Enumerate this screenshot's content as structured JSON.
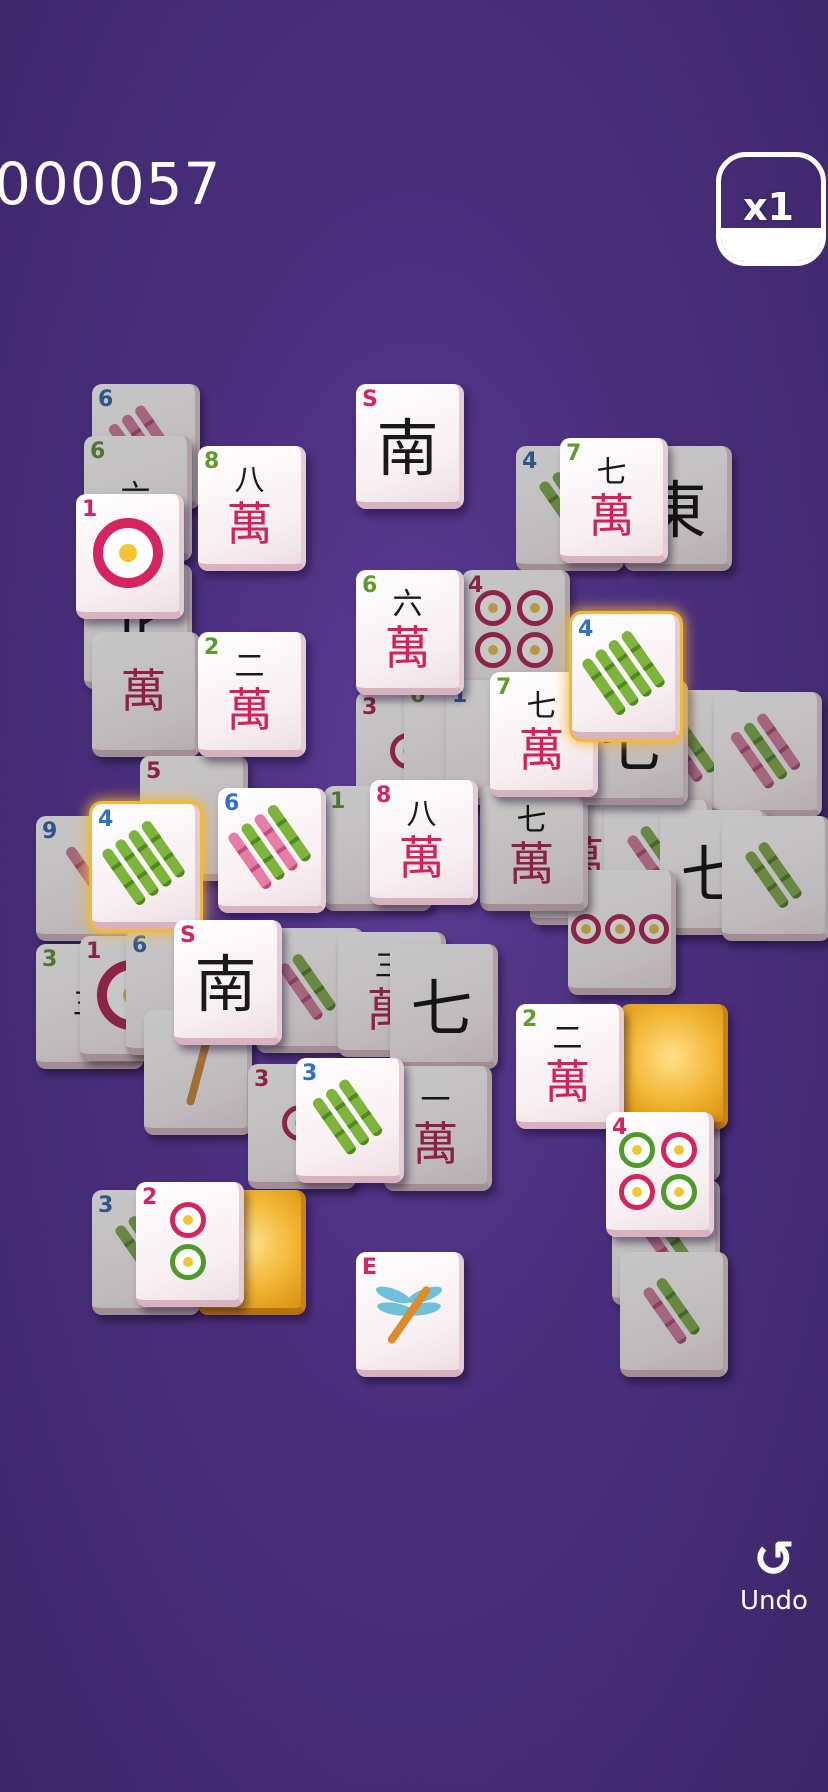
{
  "header": {
    "score": "000057",
    "multiplier": "x1"
  },
  "footer": {
    "undo_label": "Undo"
  },
  "icons": {
    "undo": "undo-arrow-icon",
    "multiplier": "multiplier-badge-icon"
  },
  "colors": {
    "background": "#4a2f7d",
    "character_red": "#d4215a",
    "bamboo_green": "#5e9b2c",
    "highlight_gold": "#f5b530"
  },
  "tiles": {
    "t1": {
      "num": "6"
    },
    "t2": {
      "num": "6",
      "top": "六"
    },
    "t3": {
      "num": "1"
    },
    "t4": {
      "num": "8",
      "top": "八",
      "wan": "萬"
    },
    "t5": {
      "num": "S",
      "big": "南"
    },
    "t6": {
      "num": "4"
    },
    "t7": {
      "num": "7",
      "top": "七",
      "wan": "萬"
    },
    "t8": {
      "big": "北"
    },
    "t9": {
      "num": "2",
      "top": "二",
      "wan": "萬"
    },
    "t10": {
      "wan": "萬"
    },
    "t11": {
      "num": "6",
      "top": "六",
      "wan": "萬"
    },
    "t12": {
      "num": "4"
    },
    "t13": {
      "num": "4"
    },
    "t14": {
      "num": "7",
      "top": "七",
      "wan": "萬"
    },
    "t15": {
      "num": "3"
    },
    "t16": {
      "num": "6"
    },
    "t17": {
      "num": "1"
    },
    "t18": {
      "num": "5"
    },
    "t19": {
      "num": "9"
    },
    "t20": {
      "num": "4"
    },
    "t21": {
      "num": "6"
    },
    "t22": {
      "num": "1"
    },
    "t23": {
      "num": "8",
      "top": "八",
      "wan": "萬"
    },
    "t24": {
      "num": "3"
    },
    "t25": {
      "num": "1"
    },
    "t26": {
      "num": "6"
    },
    "t27": {
      "num": "S",
      "big": "南"
    },
    "t28": {
      "num": "2",
      "top": "二",
      "wan": "萬"
    },
    "t29": {
      "num": "8"
    },
    "t30": {
      "num": "4"
    },
    "t31": {
      "num": "3"
    },
    "t32": {
      "num": "3"
    },
    "t33": {
      "num": "2"
    },
    "t34": {
      "num": "E"
    }
  }
}
